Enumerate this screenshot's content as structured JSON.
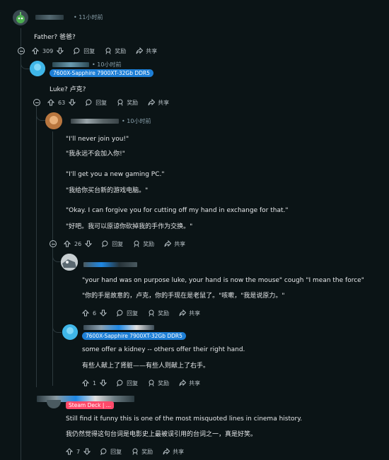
{
  "comments": [
    {
      "id": "c1",
      "time": "• 11小时前",
      "lines": [
        "Father?  爸爸?"
      ],
      "votes": "309",
      "reply": "回复",
      "award": "奖励",
      "share": "共享"
    },
    {
      "id": "c2",
      "time": "• 10小时前",
      "flair": "7600X-Sapphire 7900XT-32Gb DDR5",
      "lines": [
        "Luke?  卢克?"
      ],
      "votes": "63",
      "reply": "回复",
      "award": "奖励",
      "share": "共享"
    },
    {
      "id": "c3",
      "time": "• 10小时前",
      "lines": [
        "\"I'll never join you!\"",
        "\"我永远不会加入你!\"",
        "\"I'll get you a new gaming PC.\"",
        "\"我给你买台新的游戏电脑。\"",
        "\"Okay. I can forgive you for cutting off my hand in exchange for that.\"",
        "\"好吧。我可以原谅你砍掉我的手作为交换。\""
      ],
      "votes": "26",
      "reply": "回复",
      "award": "奖励",
      "share": "共享"
    },
    {
      "id": "c4",
      "lines": [
        "\"your hand was on purpose luke, your hand is now the mouse\" cough \"I mean the force\"",
        "\"你的手是故意的，卢克，你的手现在是老鼠了。\"咳嗽，\"我是说原力。\""
      ],
      "votes": "6",
      "reply": "回复",
      "award": "奖励",
      "share": "共享"
    },
    {
      "id": "c5",
      "flair": "7600X-Sapphire 7900XT-32Gb DDR5",
      "lines": [
        "some offer a kidney -- others offer their right hand.",
        "有些人献上了肾脏——有些人则献上了右手。"
      ],
      "votes": "1",
      "reply": "回复",
      "award": "奖励",
      "share": "共享"
    },
    {
      "id": "c6",
      "flair": "Steam Deck | ...",
      "lines": [
        "Still find it funny this is one of the most misquoted lines in cinema history.",
        "我仍然觉得这句台词是电影史上最被误引用的台词之一，真是好笑。"
      ],
      "votes": "7",
      "reply": "回复",
      "award": "奖励",
      "share": "共享"
    }
  ],
  "icons": {
    "upvote": "arrow-up-icon",
    "downvote": "arrow-down-icon",
    "reply": "speech-bubble-icon",
    "award": "award-icon",
    "share": "share-arrow-icon",
    "collapse": "collapse-minus-icon"
  },
  "colors": {
    "background": "#0b1416",
    "flair_blue": "#1e7fd6",
    "flair_red": "#ff4a6a",
    "meta": "#8ba2ad"
  }
}
